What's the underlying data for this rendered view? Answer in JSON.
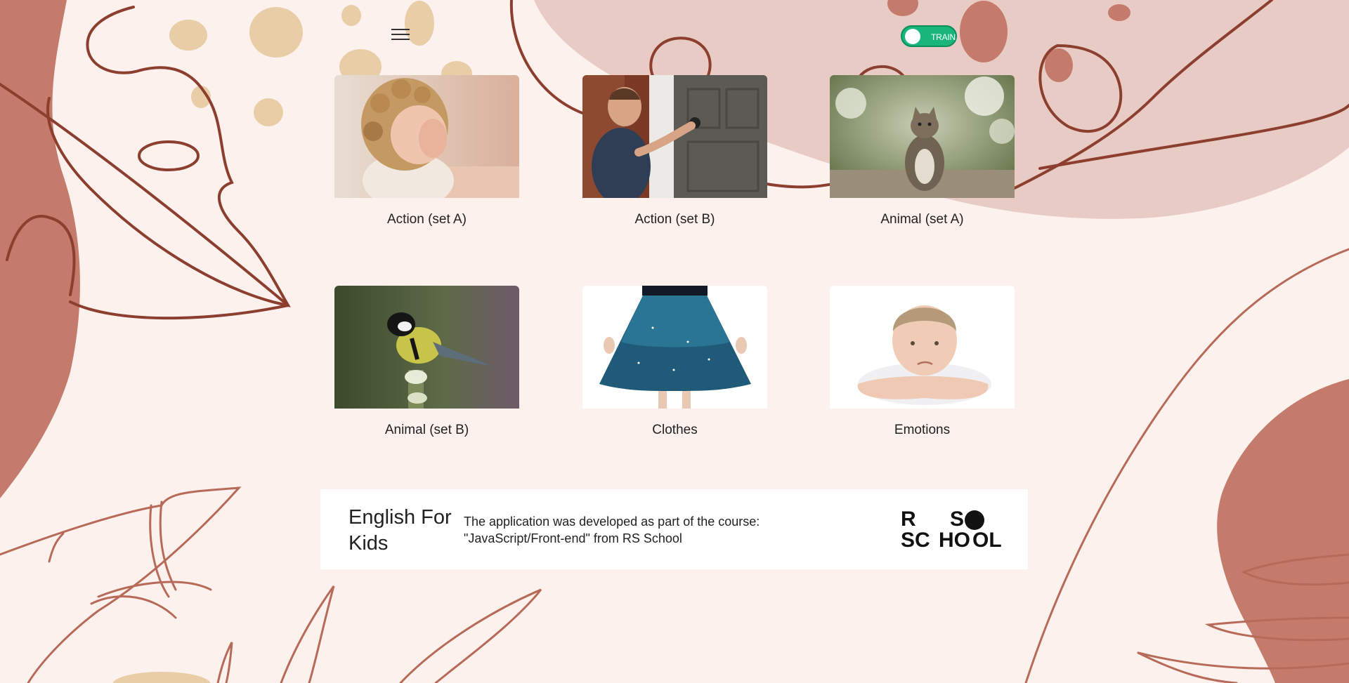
{
  "header": {
    "menu_icon": "hamburger-icon",
    "mode_toggle": {
      "label": "TRAIN",
      "color": "#19b67b"
    }
  },
  "categories": [
    {
      "label": "Action (set A)",
      "image": "child-covering-eyes-photo"
    },
    {
      "label": "Action (set B)",
      "image": "boy-opening-door-photo"
    },
    {
      "label": "Animal (set A)",
      "image": "sitting-cat-photo"
    },
    {
      "label": "Animal (set B)",
      "image": "bird-on-branch-photo"
    },
    {
      "label": "Clothes",
      "image": "blue-skirt-photo"
    },
    {
      "label": "Emotions",
      "image": "sad-boy-photo"
    }
  ],
  "footer": {
    "title": "English For Kids",
    "description_line1": "The application was developed as part of the course:",
    "description_line2": "\"JavaScript/Front-end\" from RS School",
    "logo_text": "RS SCHOOL"
  },
  "colors": {
    "background": "#fcf1ed",
    "terracotta": "#c47b6c",
    "blush": "#e9cbc5",
    "line": "#8c3f2f",
    "sand": "#e8cda6",
    "accent_green": "#19b67b"
  }
}
